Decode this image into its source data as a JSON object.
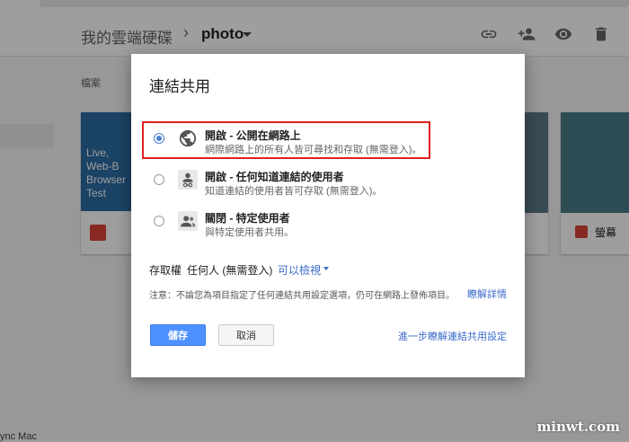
{
  "background": {
    "breadcrumb": {
      "root": "我的雲端硬碟",
      "separator": "›",
      "current": "photo"
    },
    "files_label": "檔案",
    "card1_text": "Live, Web-B Browser Test",
    "card3_label": "螢幕",
    "sync_text": "ync Mac"
  },
  "dialog": {
    "title": "連結共用",
    "options": [
      {
        "title": "開啟 - 公開在網路上",
        "desc": "網際網路上的所有人皆可尋找和存取 (無需登入)。",
        "selected": true,
        "icon": "globe-icon"
      },
      {
        "title": "開啟 - 任何知道連結的使用者",
        "desc": "知道連結的使用者皆可存取 (無需登入)。",
        "selected": false,
        "icon": "link-user-icon"
      },
      {
        "title": "關閉 - 特定使用者",
        "desc": "與特定使用者共用。",
        "selected": false,
        "icon": "people-icon"
      }
    ],
    "access": {
      "label": "存取權",
      "value": "任何人 (無需登入)",
      "permission": "可以檢視"
    },
    "note": "注意：不論您為項目指定了任何連結共用設定選項，仍可在網路上發佈項目。",
    "note_link": "瞭解詳情",
    "save_label": "儲存",
    "cancel_label": "取消",
    "learn_more": "進一步瞭解連結共用設定"
  },
  "watermark": "minwt.com",
  "colors": {
    "accent": "#4d90fe",
    "link": "#3b6bc9",
    "highlight": "#e02020"
  }
}
